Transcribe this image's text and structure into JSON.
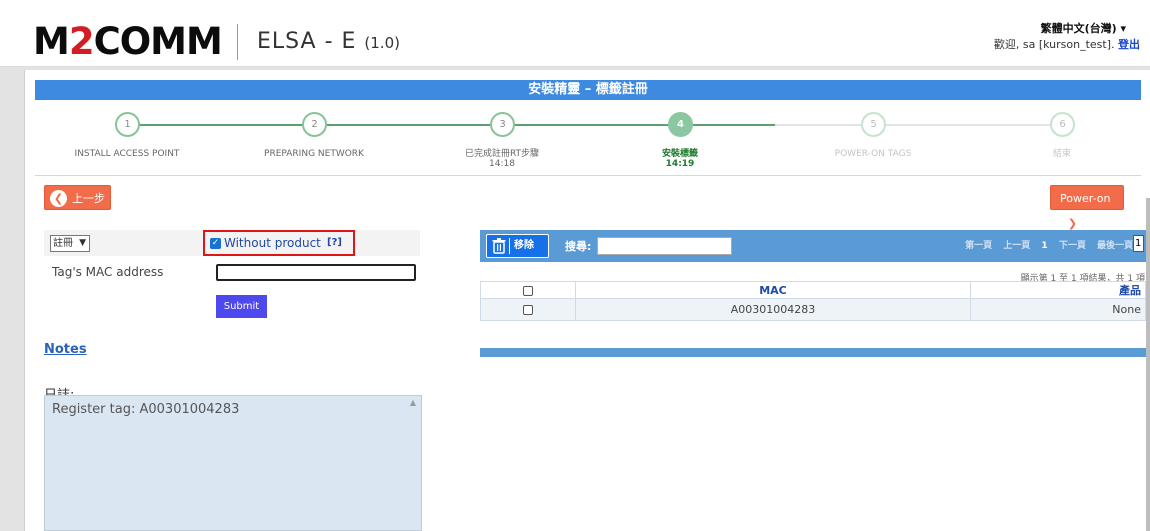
{
  "header": {
    "logo_part1": "M",
    "logo_part2": "2",
    "logo_part3": "COMM",
    "app_title": "ELSA - E",
    "app_version": "(1.0)",
    "language": "繁體中文(台灣) ▾",
    "welcome_text": "歡迎, sa [kurson_test].",
    "logout": "登出"
  },
  "wizard": {
    "title": "安裝精靈 – 標籤註冊",
    "steps": [
      {
        "num": "1",
        "label": "INSTALL ACCESS POINT",
        "time": "",
        "state": "done"
      },
      {
        "num": "2",
        "label": "PREPARING NETWORK",
        "time": "",
        "state": "done"
      },
      {
        "num": "3",
        "label": "已完成註冊RT步驟",
        "time": "14:18",
        "state": "done"
      },
      {
        "num": "4",
        "label": "安裝標籤",
        "time": "14:19",
        "state": "active"
      },
      {
        "num": "5",
        "label": "POWER-ON TAGS",
        "time": "",
        "state": "pending"
      },
      {
        "num": "6",
        "label": "結束",
        "time": "",
        "state": "pending"
      }
    ],
    "back_label": "上一步",
    "next_label": "Power-on"
  },
  "form": {
    "mode_select": "註冊",
    "without_product_label": "Without product",
    "help_label": "[?]",
    "mac_label": "Tag's MAC address",
    "mac_value": "",
    "submit_label": "Submit"
  },
  "notes_label": "Notes",
  "log": {
    "label": "日誌:",
    "text": "Register tag: A00301004283"
  },
  "table": {
    "delete_label": "移除",
    "search_label": "搜尋:",
    "search_value": "",
    "pager": {
      "first": "第一頁",
      "prev": "上一頁",
      "current": "1",
      "next": "下一頁",
      "last": "最後一頁",
      "page_input": "1"
    },
    "showing": "顯示第 1 至 1 項結果，共 1 項",
    "columns": [
      "MAC",
      "產品"
    ],
    "rows": [
      {
        "mac": "A00301004283",
        "product": "None"
      }
    ]
  },
  "colors": {
    "wizard_blue": "#3d8ae0",
    "table_blue": "#5b9bd5",
    "step_green": "#86c498",
    "orange_button": "#f26c4a",
    "submit_purple": "#4e48ef"
  }
}
